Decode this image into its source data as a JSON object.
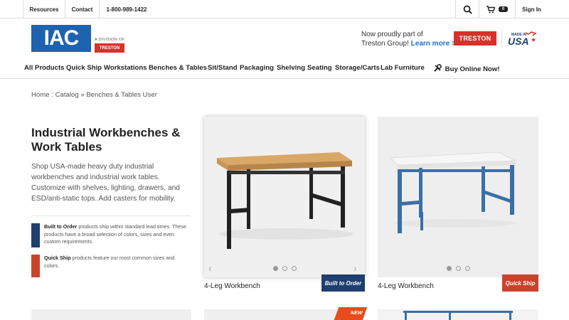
{
  "topbar": {
    "resources": "Resources",
    "contact": "Contact",
    "phone": "1-800-989-1422",
    "cart_count": "0",
    "sign_in": "Sign In"
  },
  "header": {
    "logo": "IAC",
    "division": "A DIVISION OF",
    "division_brand": "TRESTON",
    "tagline_line1": "Now proudly part of",
    "tagline_line2": "Treston Group!",
    "learn_more": "Learn more >",
    "treston_logo": "TRESTON",
    "made_in": "MADE IN",
    "usa": "USA"
  },
  "nav": {
    "items": [
      "All Products",
      "Quick Ship",
      "Workstations",
      "Benches & Tables",
      "Sit/Stand",
      "Packaging",
      "Shelving",
      "Seating",
      "Storage/Carts",
      "Lab Furniture"
    ],
    "buy_online": "Buy Online Now!"
  },
  "breadcrumb": {
    "home": "Home",
    "sep1": ":",
    "catalog": "Catalog",
    "sep2": "»",
    "current": "Benches & Tables User"
  },
  "main": {
    "title": "Industrial Workbenches & Work Tables",
    "intro": "Shop USA-made heavy duty industrial workbenches and industrial work tables. Customize with shelves, lighting, drawers, and ESD/anti-static tops. Add casters for mobility."
  },
  "legend": [
    {
      "label": "Built to Order",
      "text": " products ship within standard lead times. These products have a broad selection of colors, sizes and even custom requirements.",
      "color": "#1f3f6e"
    },
    {
      "label": "Quick Ship",
      "text": " products feature our most common sizes and colors.",
      "color": "#c9432b"
    }
  ],
  "products": [
    {
      "name": "4-Leg Workbench",
      "badge": "Built to Order",
      "badge_color": "#1f3f6e",
      "top_color": "#d9a868",
      "frame_color": "#222222"
    },
    {
      "name": "4-Leg Workbench",
      "badge": "Quick Ship",
      "badge_color": "#c9432b",
      "top_color": "#f4f4f4",
      "frame_color": "#3b6fa5"
    }
  ],
  "new_tag": "NEW",
  "icons": {
    "search": "search-icon",
    "cart": "cart-icon",
    "buy_online": "tools-icon",
    "carousel_prev": "chevron-left-icon",
    "carousel_next": "chevron-right-icon"
  }
}
